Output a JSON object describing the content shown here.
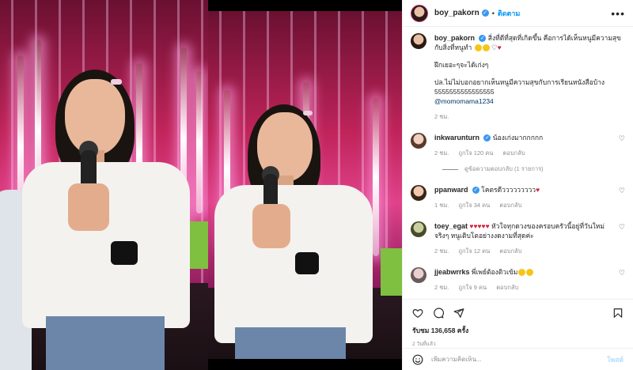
{
  "post": {
    "author": "boy_pakorn",
    "follow_label": "ติดตาม",
    "more_label": "•••",
    "separator": "•"
  },
  "caption": {
    "username": "boy_pakorn",
    "line1": "สิ่งที่ดีที่สุดที่เกิดขึ้น คือการได้เห็นหนูมีความสุขกับสิ่งที่หนูทำ",
    "line2": "ฝึกเยอะๆจะได้เก่งๆ",
    "line3": "ปล.ไม่ไม่บอกอยากเห็นหนูมีความสุขกับการเรียนหนังสือบ้าง 5555555555555555",
    "mention": "@momomama1234",
    "time": "2 ชม."
  },
  "comments": [
    {
      "username": "inkwarunturn",
      "verified": true,
      "text": "น้องเก่งมากกกกก",
      "time": "2 ชม.",
      "likes": "ถูกใจ 120 คน",
      "reply_label": "ตอบกลับ",
      "view_replies": "ดูข้อความตอบกลับ (1 รายการ)"
    },
    {
      "username": "ppanward",
      "verified": true,
      "text": "โคตรดีววววววววว",
      "time": "1 ชม.",
      "likes": "ถูกใจ 34 คน",
      "reply_label": "ตอบกลับ"
    },
    {
      "username": "toey_egat",
      "verified": false,
      "text": "หัวใจทุกดวงของครอบครัวนี้อยู่ที่วันใหม่จริงๆ หนูเติบโตอย่างงดงามที่สุดค่ะ",
      "time": "2 ชม.",
      "likes": "ถูกใจ 12 คน",
      "reply_label": "ตอบกลับ"
    },
    {
      "username": "jjeabwrrks",
      "verified": false,
      "text": "พี่เพย์ต้องติวเข้ม",
      "time": "2 ชม.",
      "likes": "ถูกใจ 9 คน",
      "reply_label": "ตอบกลับ"
    }
  ],
  "stats": {
    "views": "รับชม 136,658 ครั้ง",
    "time_ago": "2 วันที่แล้ว"
  },
  "composer": {
    "placeholder": "เพิ่มความคิดเห็น...",
    "post_label": "โพสต์"
  },
  "colors": {
    "accent": "#0095f6",
    "verified": "#3897f0",
    "heart": "#d21f3c",
    "link": "#00376b"
  },
  "icons": [
    "heart-icon",
    "comment-icon",
    "share-icon",
    "bookmark-icon",
    "smile-icon",
    "more-icon",
    "verified-icon"
  ]
}
